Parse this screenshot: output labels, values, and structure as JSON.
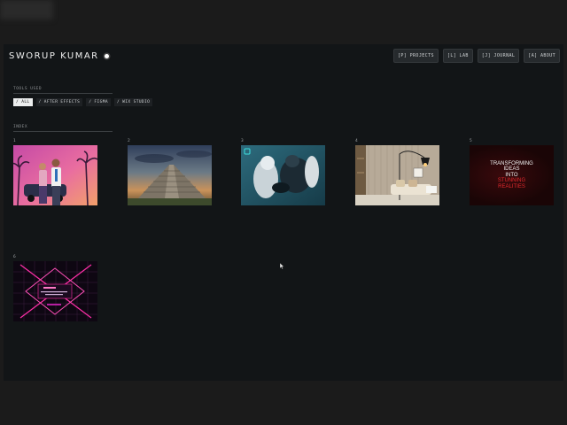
{
  "brand": {
    "name": "SWORUP KUMAR"
  },
  "nav": [
    {
      "label": "[P] PROJECTS"
    },
    {
      "label": "[L] LAB"
    },
    {
      "label": "[J] JOURNAL"
    },
    {
      "label": "[A] ABOUT"
    }
  ],
  "tools": {
    "heading": "TOOLS USED",
    "filters": [
      {
        "label": "/ ALL",
        "active": true
      },
      {
        "label": "/ AFTER EFFECTS",
        "active": false
      },
      {
        "label": "/ FIGMA",
        "active": false
      },
      {
        "label": "/ WIX STUDIO",
        "active": false
      }
    ]
  },
  "index": {
    "heading": "INDEX",
    "items": [
      {
        "number": "1"
      },
      {
        "number": "2"
      },
      {
        "number": "3"
      },
      {
        "number": "4"
      },
      {
        "number": "5",
        "caption_lines": [
          "TRANSFORMING",
          "IDEAS",
          "INTO",
          "STUNNING",
          "REALITIES"
        ]
      },
      {
        "number": "6"
      }
    ]
  },
  "colors": {
    "page_bg": "#1b1b1b",
    "app_bg": "#121517",
    "accent_red": "#e0282c",
    "neon_pink": "#ff2fa8"
  }
}
